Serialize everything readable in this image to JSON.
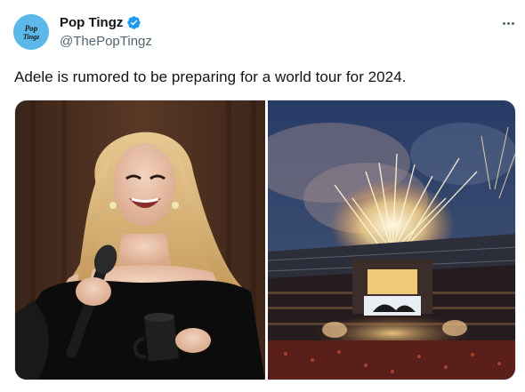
{
  "author": {
    "display_name": "Pop Tingz",
    "handle": "@ThePopTingz",
    "verified": true,
    "avatar_text": "Pop Tingz",
    "verified_color": "#1d9bf0"
  },
  "tweet": {
    "text": "Adele is rumored to be preparing for a world tour for 2024."
  },
  "media": {
    "left_image": "adele-singing-photo",
    "right_image": "stadium-concert-fireworks-photo"
  },
  "icons": {
    "verified": "verified-badge-icon",
    "more": "more-options-icon"
  }
}
